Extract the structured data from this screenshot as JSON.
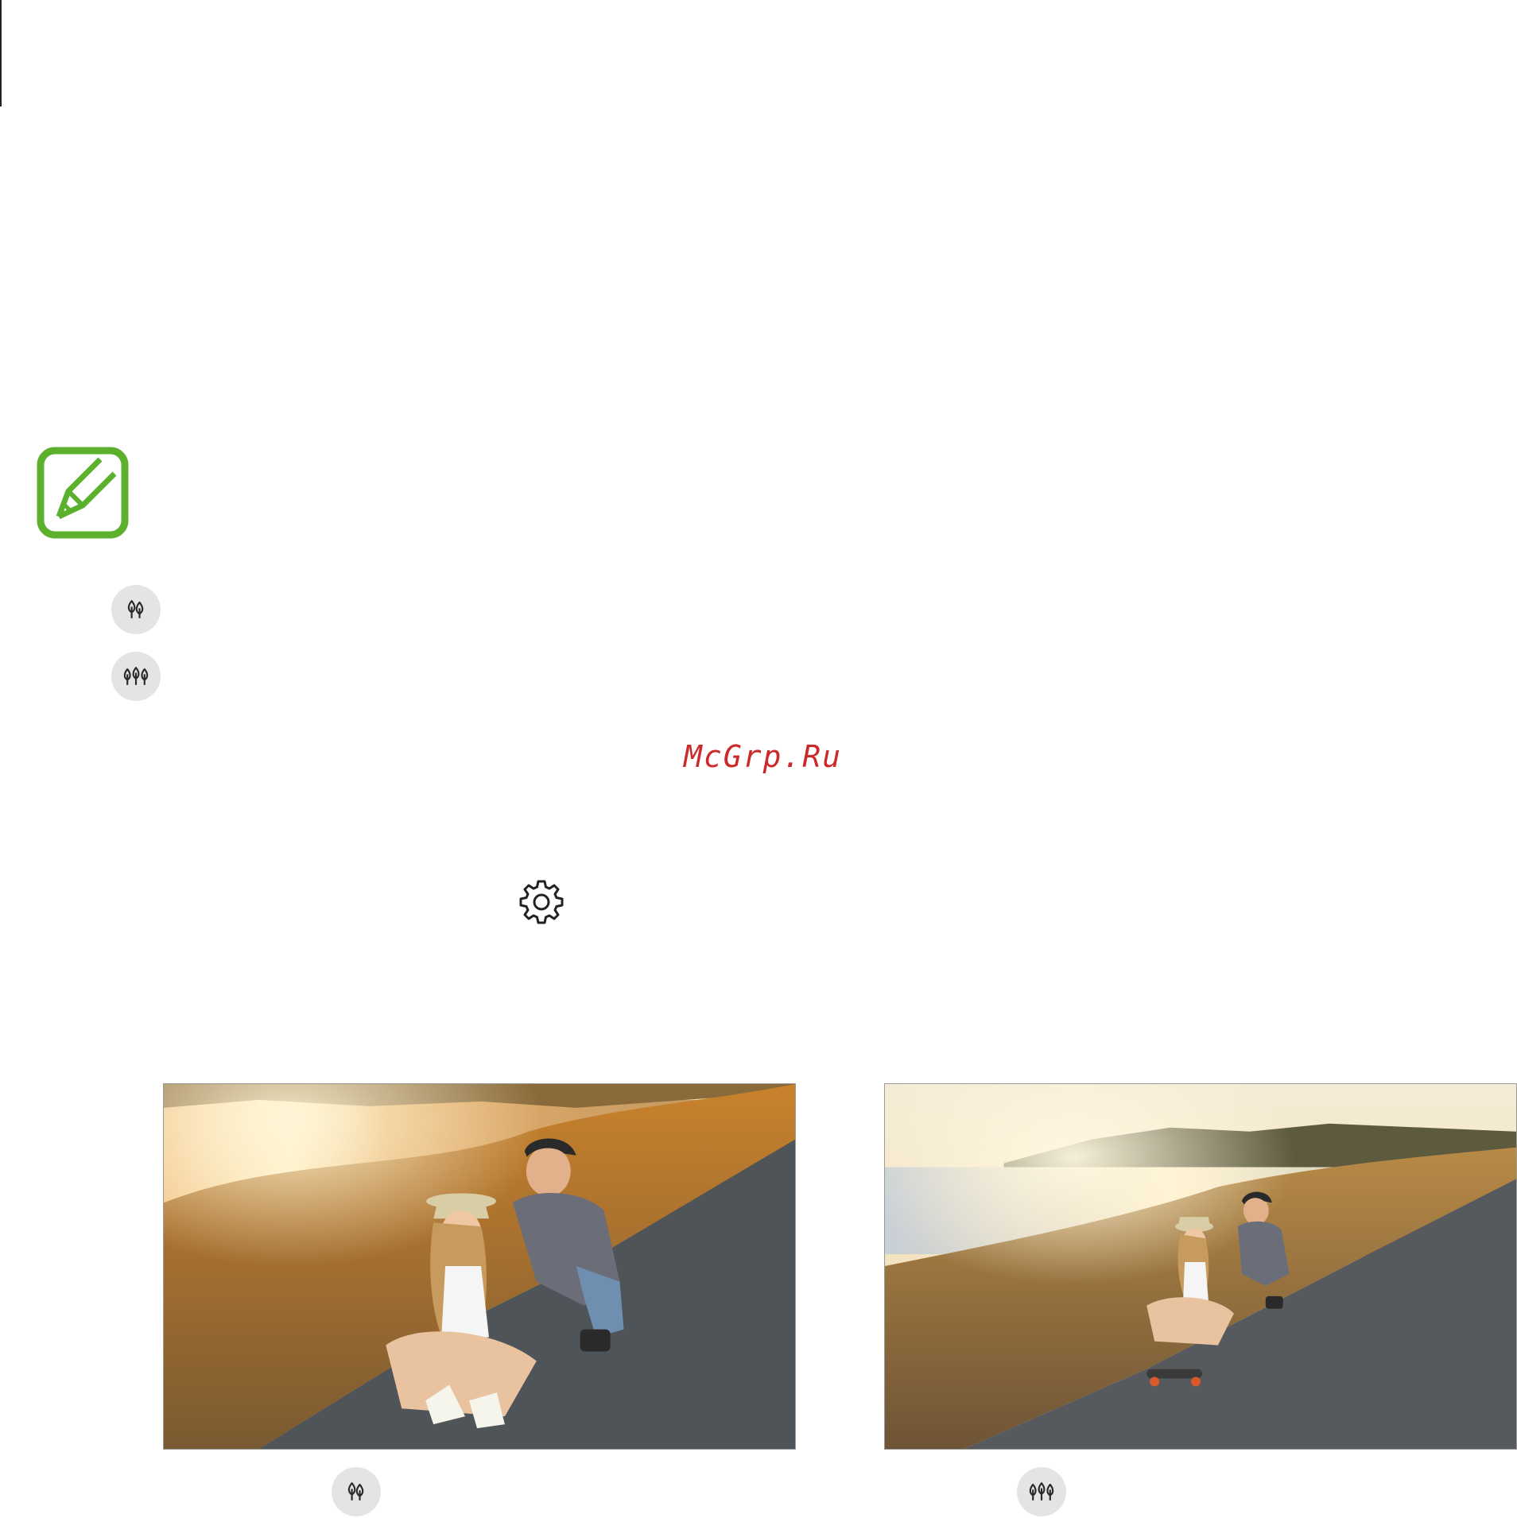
{
  "watermark": {
    "text": "McGrp.Ru"
  },
  "icons": {
    "note": "note-pencil-icon",
    "single_mode": "single-tree-icon",
    "multi_mode": "multi-tree-icon",
    "settings": "gear-icon"
  },
  "colors": {
    "note_green": "#5bb02e",
    "watermark_red": "#cc2a2a",
    "icon_bg": "#e4e4e4"
  },
  "photos": [
    {
      "id": "photo-single",
      "mode": "single"
    },
    {
      "id": "photo-multi",
      "mode": "multi"
    }
  ]
}
